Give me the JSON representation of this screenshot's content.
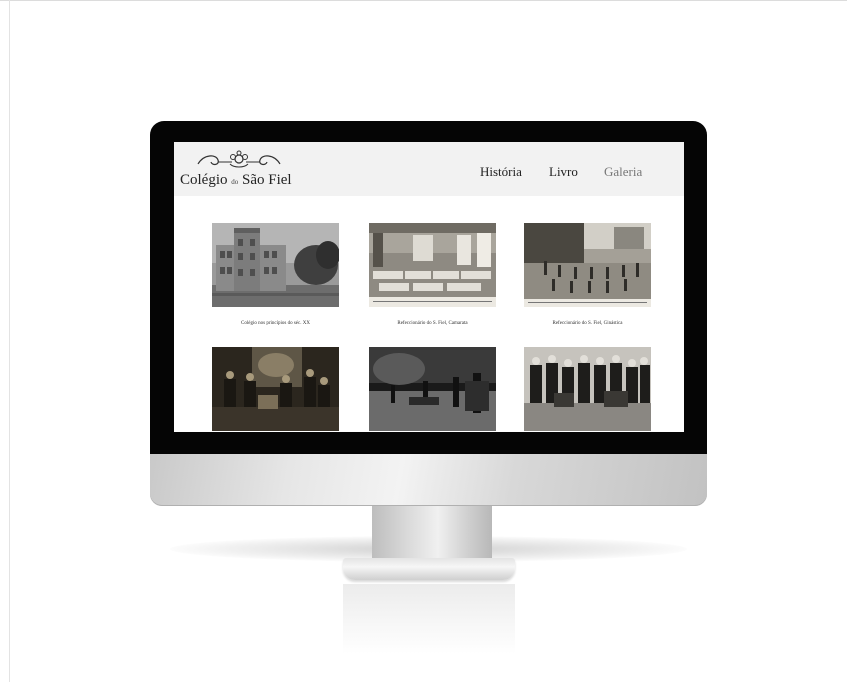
{
  "site": {
    "logo_prefix": "Colégio",
    "logo_small": "do",
    "logo_suffix": "São Fiel"
  },
  "nav": {
    "items": [
      {
        "label": "História"
      },
      {
        "label": "Livro"
      },
      {
        "label": "Galeria"
      }
    ]
  },
  "gallery": {
    "items": [
      {
        "caption": "Colégio nos princípios do séc. XX",
        "scene": "school-building-photo"
      },
      {
        "caption": "Refeccionário do S. Fiel, Camarata",
        "scene": "dormitory-photo"
      },
      {
        "caption": "Refeccionário do S. Fiel, Ginástica",
        "scene": "gymnastics-photo"
      },
      {
        "caption": "",
        "scene": "laboratory-photo"
      },
      {
        "caption": "",
        "scene": "workshop-photo"
      },
      {
        "caption": "",
        "scene": "students-group-photo"
      }
    ]
  },
  "colors": {
    "bezel": "#050505",
    "header_bg": "#f2f2f2",
    "nav_active": "#777777",
    "text": "#222222"
  }
}
